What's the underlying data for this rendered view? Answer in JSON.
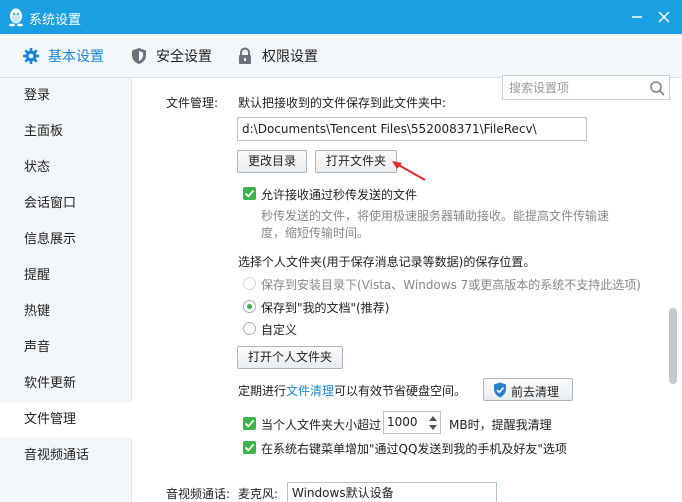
{
  "window": {
    "title": "系统设置"
  },
  "tabs": [
    {
      "label": "基本设置",
      "icon": "gear-icon",
      "active": true
    },
    {
      "label": "安全设置",
      "icon": "shield-icon"
    },
    {
      "label": "权限设置",
      "icon": "lock-icon"
    }
  ],
  "search": {
    "placeholder": "搜索设置项",
    "value": ""
  },
  "sidebar": {
    "items": [
      {
        "label": "登录"
      },
      {
        "label": "主面板"
      },
      {
        "label": "状态"
      },
      {
        "label": "会话窗口"
      },
      {
        "label": "信息展示"
      },
      {
        "label": "提醒"
      },
      {
        "label": "热键"
      },
      {
        "label": "声音"
      },
      {
        "label": "软件更新"
      },
      {
        "label": "文件管理",
        "active": true
      },
      {
        "label": "音视频通话"
      }
    ]
  },
  "file_mgmt": {
    "section_label": "文件管理:",
    "save_desc": "默认把接收到的文件保存到此文件夹中:",
    "path": "d:\\Documents\\Tencent Files\\552008371\\FileRecv\\",
    "change_dir_btn": "更改目录",
    "open_folder_btn": "打开文件夹",
    "allow_flash_label": "允许接收通过秒传发送的文件",
    "allow_flash_desc_1": "秒传发送的文件，将使用极速服务器辅助接收。能提高文件传输速",
    "allow_flash_desc_2": "度，缩短传输时间。",
    "personal_folder_title": "选择个人文件夹(用于保存消息记录等数据)的保存位置。",
    "radio_install": "保存到安装目录下(Vista、Windows 7或更高版本的系统不支持此选项)",
    "radio_mydocs": "保存到\"我的文档\"(推荐)",
    "radio_custom": "自定义",
    "open_personal_btn": "打开个人文件夹",
    "clean_prefix": "定期进行",
    "clean_link": "文件清理",
    "clean_suffix": "可以有效节省硬盘空间。",
    "clean_btn": "前去清理",
    "size_prefix": "当个人文件夹大小超过",
    "size_value": "1000",
    "size_suffix": "MB时，提醒我清理",
    "context_menu_label": "在系统右键菜单增加\"通过QQ发送到我的手机及好友\"选项"
  },
  "av_call": {
    "label": "音视频通话:",
    "mic_label": "麦克风:",
    "mic_value": "Windows默认设备"
  },
  "colors": {
    "titlebar": "#1a9fe3",
    "accent": "#1a87d6",
    "check": "#3bb34a",
    "annotation_arrow": "#e52a2a"
  }
}
